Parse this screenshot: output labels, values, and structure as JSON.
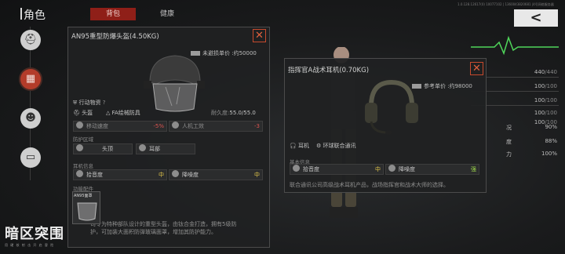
{
  "header": {
    "title": "角色",
    "tabs": [
      {
        "label": "背包",
        "active": true
      },
      {
        "label": "健康",
        "active": false
      }
    ],
    "version": "1.0.128.12617(0) 10077102 | 1360043820681 |4号网络服务器",
    "back_label": "<"
  },
  "sidebar": {
    "items": [
      {
        "icon": "soldier-helmet-icon",
        "active": false
      },
      {
        "icon": "tactical-vest-icon",
        "active": true
      },
      {
        "icon": "health-body-icon",
        "active": false
      },
      {
        "icon": "briefcase-icon",
        "active": false
      }
    ]
  },
  "logo": {
    "main": "暗区突围",
    "sub": "用 硬 核 射 击 开 启 冒 险"
  },
  "stats": {
    "rows": [
      {
        "value": "440",
        "max": "/440"
      },
      {
        "value": "100",
        "max": "/100"
      },
      {
        "value": "100",
        "max": "/100"
      },
      {
        "value": "100",
        "max": "/100"
      },
      {
        "value": "100",
        "max": "/100"
      }
    ],
    "labels": [
      {
        "label": "况",
        "pct": "90%"
      },
      {
        "label": "度",
        "pct": "88%"
      },
      {
        "label": "力",
        "pct": "100%"
      }
    ],
    "accent": "#4fd65a"
  },
  "helmet_panel": {
    "title": "AN95重型防爆头盔(4.50KG)",
    "price": "未避损单价 :约50000",
    "action_label": "行动物资",
    "help": "?",
    "slot": "头盔",
    "protection": "FA绘械防具",
    "durability_label": "耐久度:",
    "durability": "55.0/55.0",
    "modifiers": [
      {
        "label": "移动速度",
        "value": "-5%"
      },
      {
        "label": "人机工效",
        "value": "-3"
      }
    ],
    "protect_section": "防护区域",
    "zones": [
      "头顶",
      "耳部"
    ],
    "hearing_section": "耳机信息",
    "hearing": [
      {
        "label": "拾音度",
        "value": "中"
      },
      {
        "label": "降噪度",
        "value": "中"
      }
    ],
    "mod_section": "功能配件",
    "mod_name": "AN95面罩",
    "description": "司专为特种部队设计的重型头盔，由钛合金打造，拥有5级防\n护，可加装大面积防弹玻璃面罩，增加其防护能力。"
  },
  "headset_panel": {
    "title": "指挥官A战术耳机(0.70KG)",
    "price": "参考单价 :约98000",
    "slot": "耳机",
    "protection": "环球联合通讯",
    "basic_section": "基本信息",
    "hearing": [
      {
        "label": "拾音度",
        "value": "中"
      },
      {
        "label": "降噪度",
        "value": "强"
      }
    ],
    "description": "联合通讯公司高级战术耳机产品，战场指挥官和战术大师的选择。"
  },
  "colors": {
    "accent_red": "#8f1f18",
    "close": "#c74a2d",
    "green": "#9bd44a",
    "yellow": "#e2c64a"
  }
}
